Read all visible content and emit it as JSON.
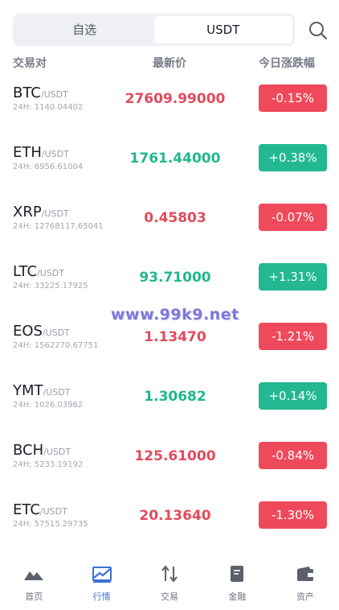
{
  "tabs": [
    {
      "label": "自选",
      "active": false
    },
    {
      "label": "USDT",
      "active": true
    }
  ],
  "search": {
    "icon": "search-icon"
  },
  "columns": {
    "pair": "交易对",
    "price": "最新价",
    "change": "今日涨跌幅"
  },
  "rows": [
    {
      "base": "BTC",
      "quote": "/USDT",
      "volume": "24H: 1140.04402",
      "price": "27609.99000",
      "change": "-0.15%",
      "direction": "down"
    },
    {
      "base": "ETH",
      "quote": "/USDT",
      "volume": "24H: 6956.61004",
      "price": "1761.44000",
      "change": "+0.38%",
      "direction": "up"
    },
    {
      "base": "XRP",
      "quote": "/USDT",
      "volume": "24H: 12768117.65041",
      "price": "0.45803",
      "change": "-0.07%",
      "direction": "down"
    },
    {
      "base": "LTC",
      "quote": "/USDT",
      "volume": "24H: 33225.17925",
      "price": "93.71000",
      "change": "+1.31%",
      "direction": "up"
    },
    {
      "base": "EOS",
      "quote": "/USDT",
      "volume": "24H: 1562270.67751",
      "price": "1.13470",
      "change": "-1.21%",
      "direction": "down"
    },
    {
      "base": "YMT",
      "quote": "/USDT",
      "volume": "24H: 1026.03962",
      "price": "1.30682",
      "change": "+0.14%",
      "direction": "up"
    },
    {
      "base": "BCH",
      "quote": "/USDT",
      "volume": "24H: 5233.19192",
      "price": "125.61000",
      "change": "-0.84%",
      "direction": "down"
    },
    {
      "base": "ETC",
      "quote": "/USDT",
      "volume": "24H: 57515.29735",
      "price": "20.13640",
      "change": "-1.30%",
      "direction": "down"
    }
  ],
  "watermark": "www.99k9.net",
  "nav": [
    {
      "label": "首页",
      "icon": "home-icon",
      "active": false
    },
    {
      "label": "行情",
      "icon": "market-chart-icon",
      "active": true
    },
    {
      "label": "交易",
      "icon": "trade-arrows-icon",
      "active": false
    },
    {
      "label": "金融",
      "icon": "finance-book-icon",
      "active": false
    },
    {
      "label": "资产",
      "icon": "wallet-icon",
      "active": false
    }
  ],
  "colors": {
    "up": "#22b68f",
    "down": "#e24b5c",
    "up_badge": "#23b891",
    "down_badge": "#ef4a5b",
    "accent": "#3b6fd8"
  }
}
